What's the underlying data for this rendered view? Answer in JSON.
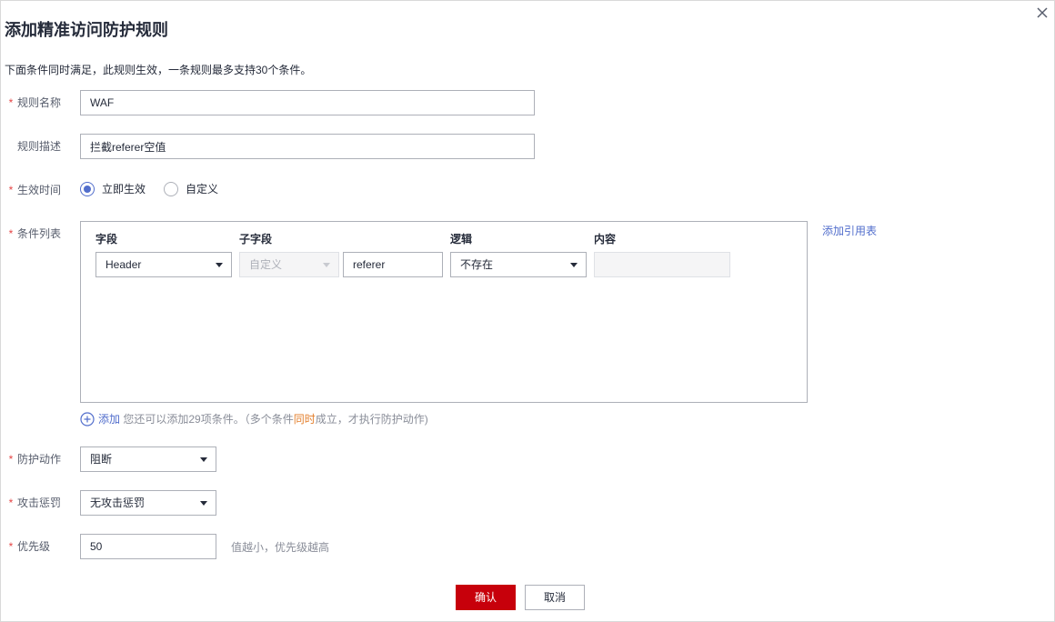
{
  "dialog": {
    "title": "添加精准访问防护规则",
    "description": "下面条件同时满足，此规则生效，一条规则最多支持30个条件。"
  },
  "form": {
    "required_mark": "*",
    "rule_name": {
      "label": "规则名称",
      "value": "WAF"
    },
    "rule_desc": {
      "label": "规则描述",
      "value": "拦截referer空值"
    },
    "effective_time": {
      "label": "生效时间",
      "options": [
        {
          "label": "立即生效",
          "checked": true
        },
        {
          "label": "自定义",
          "checked": false
        }
      ]
    },
    "condition_list": {
      "label": "条件列表",
      "headers": {
        "field": "字段",
        "subfield": "子字段",
        "logic": "逻辑",
        "content": "内容"
      },
      "rows": [
        {
          "field": "Header",
          "subfield_select": "自定义",
          "subfield_value": "referer",
          "logic": "不存在",
          "content": ""
        }
      ],
      "add_reference_table": "添加引用表",
      "add_label": "添加",
      "add_hint_1": "您还可以添加29项条件。（多个条件",
      "add_hint_highlight": "同时",
      "add_hint_2": "成立，才执行防护动作)"
    },
    "protective_action": {
      "label": "防护动作",
      "value": "阻断"
    },
    "attack_penalty": {
      "label": "攻击惩罚",
      "value": "无攻击惩罚"
    },
    "priority": {
      "label": "优先级",
      "value": "50",
      "hint": "值越小，优先级越高"
    }
  },
  "footer": {
    "confirm_label": "确认",
    "cancel_label": "取消"
  },
  "colors": {
    "primary": "#c7000b",
    "link": "#526ecc",
    "required": "#e54545",
    "highlight": "#e37d29"
  },
  "icons": {
    "close": "close-icon",
    "add": "plus-circle-icon",
    "dropdown": "caret-down-icon"
  }
}
